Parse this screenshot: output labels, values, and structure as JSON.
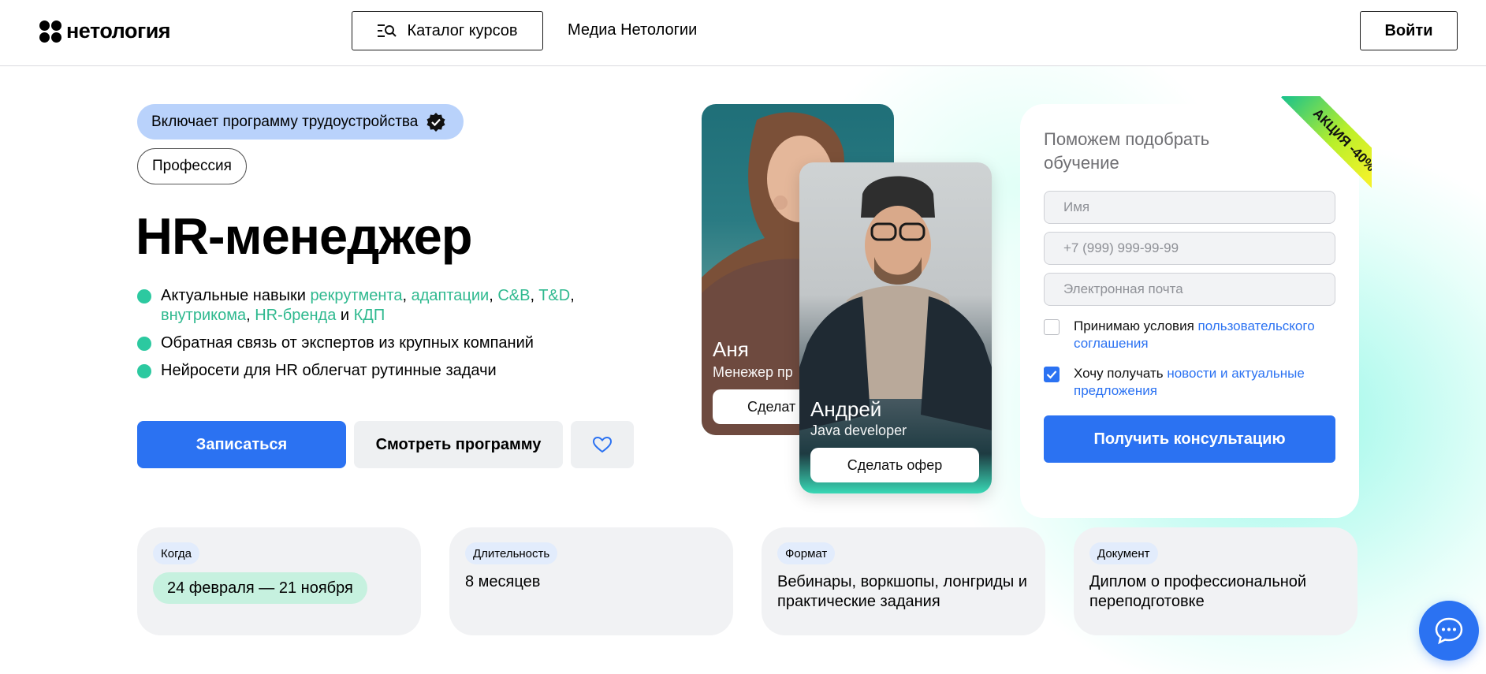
{
  "header": {
    "logo_text": "нетология",
    "catalog_label": "Каталог курсов",
    "media_label": "Медиа Нетологии",
    "login_label": "Войти"
  },
  "hero": {
    "badge_employment": "Включает программу трудоустройства",
    "badge_profession": "Профессия",
    "title": "HR-менеджер",
    "features": {
      "f1": {
        "prefix": "Актуальные навыки ",
        "h1": "рекрутмента",
        "sep1": ", ",
        "h2": "адаптации",
        "sep2": ", ",
        "h3": "C&B",
        "sep3": ", ",
        "h4": "T&D",
        "sep4": ",",
        "h5": "внутрикома",
        "sep5": ", ",
        "h6": "HR-бренда",
        "sep6": " и ",
        "h7": "КДП"
      },
      "f2": "Обратная связь от экспертов из крупных компаний",
      "f3": "Нейросети для HR облегчат рутинные задачи"
    },
    "enroll_label": "Записаться",
    "program_label": "Смотреть программу",
    "favorite_icon": "heart-icon",
    "accent_color": "#2b72f2",
    "highlight_color": "#2fb98f"
  },
  "cards": {
    "anya": {
      "name": "Аня",
      "role": "Менежер пр",
      "button": "Сделат"
    },
    "andrey": {
      "name": "Андрей",
      "role": "Java developer",
      "button": "Сделать офер"
    }
  },
  "form": {
    "promo": "АКЦИЯ -40%",
    "title": "Поможем подобрать обучение",
    "name_placeholder": "Имя",
    "phone_placeholder": "+7 (999) 999-99-99",
    "email_placeholder": "Электронная почта",
    "agree_text": "Принимаю условия ",
    "agree_link": "пользовательского соглашения",
    "agree_checked": false,
    "news_text": "Хочу получать ",
    "news_link": "новости и актуальные предложения",
    "news_checked": true,
    "submit_label": "Получить консультацию"
  },
  "info": {
    "when": {
      "label": "Когда",
      "value": "24 февраля — 21 ноября"
    },
    "duration": {
      "label": "Длительность",
      "value": "8 месяцев"
    },
    "format": {
      "label": "Формат",
      "value": "Вебинары, воркшопы, лонгриды и практические задания"
    },
    "document": {
      "label": "Документ",
      "value": "Диплом о профессиональной переподготовке"
    }
  },
  "chat_icon": "chat-bubble-icon"
}
